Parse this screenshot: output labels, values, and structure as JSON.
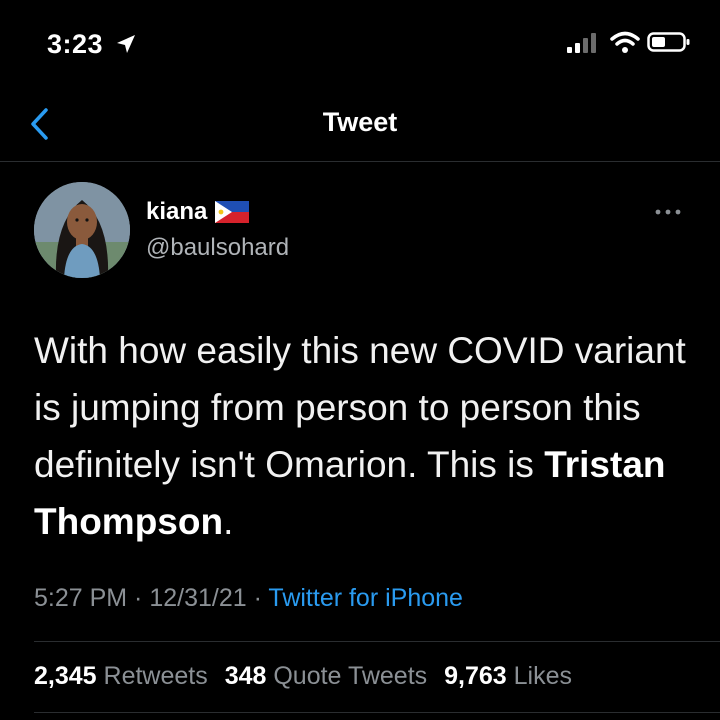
{
  "status_bar": {
    "time": "3:23"
  },
  "nav": {
    "title": "Tweet"
  },
  "author": {
    "name": "kiana",
    "handle": "@baulsohard",
    "flag": "philippines-flag-icon"
  },
  "tweet": {
    "text_before_bold": "With how easily this new COVID variant is jumping from person to person this definitely isn't Omarion. This is ",
    "bold_text": "Tristan Thompson",
    "text_after_bold": "."
  },
  "meta": {
    "time": "5:27 PM",
    "separator_1": " · ",
    "date": "12/31/21",
    "separator_2": " · ",
    "source": "Twitter for iPhone"
  },
  "stats": {
    "retweets_count": "2,345",
    "retweets_label": "Retweets",
    "quotes_count": "348",
    "quotes_label": "Quote Tweets",
    "likes_count": "9,763",
    "likes_label": "Likes"
  },
  "colors": {
    "background": "#000000",
    "accent": "#2a9bf0",
    "muted": "#8b9095"
  }
}
